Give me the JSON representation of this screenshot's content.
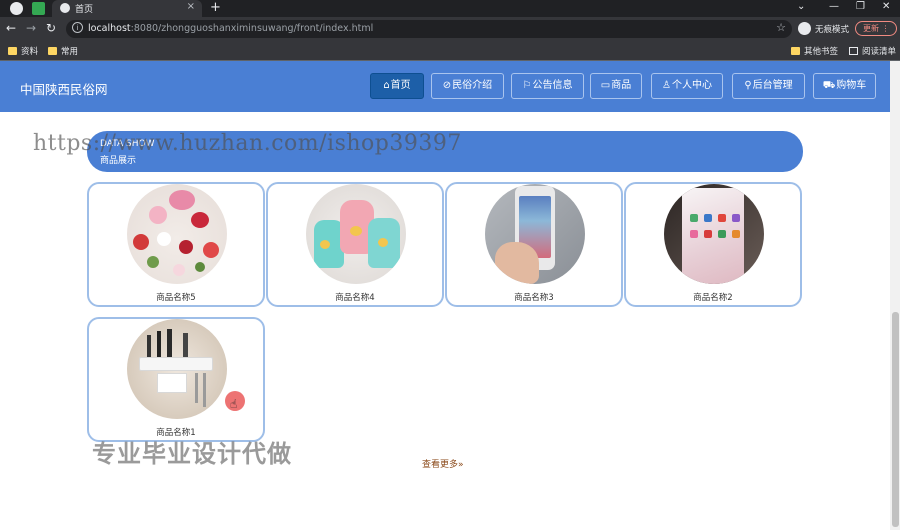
{
  "browser": {
    "tab_title": "首页",
    "url_host": "localhost",
    "url_rest": ":8080/zhongguoshanximinsuwang/front/index.html",
    "incognito_label": "无痕模式",
    "update_label": "更新",
    "bookmarks": [
      "资料",
      "常用"
    ],
    "bookmarks_right": [
      "其他书签",
      "阅读清单"
    ]
  },
  "site": {
    "title": "中国陕西民俗网",
    "nav": [
      {
        "icon": "home-icon",
        "glyph": "⌂",
        "label": "首页",
        "active": true
      },
      {
        "icon": "link-icon",
        "glyph": "⊘",
        "label": "民俗介绍",
        "active": false
      },
      {
        "icon": "flag-icon",
        "glyph": "⚐",
        "label": "公告信息",
        "active": false
      },
      {
        "icon": "shop-icon",
        "glyph": "▭",
        "label": "商品",
        "active": false
      },
      {
        "icon": "user-icon",
        "glyph": "♙",
        "label": "个人中心",
        "active": false
      },
      {
        "icon": "chain-icon",
        "glyph": "⚲",
        "label": "后台管理",
        "active": false
      },
      {
        "icon": "cart-icon",
        "glyph": "⛟",
        "label": "购物车",
        "active": false
      }
    ]
  },
  "section": {
    "title_en": "DATA SHOW",
    "title_zh": "商品展示",
    "more_label": "查看更多»"
  },
  "products": [
    {
      "name": "商品名称5",
      "image": "flowers-photo"
    },
    {
      "name": "商品名称4",
      "image": "cups-photo"
    },
    {
      "name": "商品名称3",
      "image": "phone-in-hand-photo"
    },
    {
      "name": "商品名称2",
      "image": "phone-screen-photo"
    },
    {
      "name": "商品名称1",
      "image": "kitchen-rack-photo"
    }
  ],
  "overlay": {
    "watermark_url": "https://www.huzhan.com/ishop39397",
    "watermark_text": "专业毕业设计代做"
  }
}
